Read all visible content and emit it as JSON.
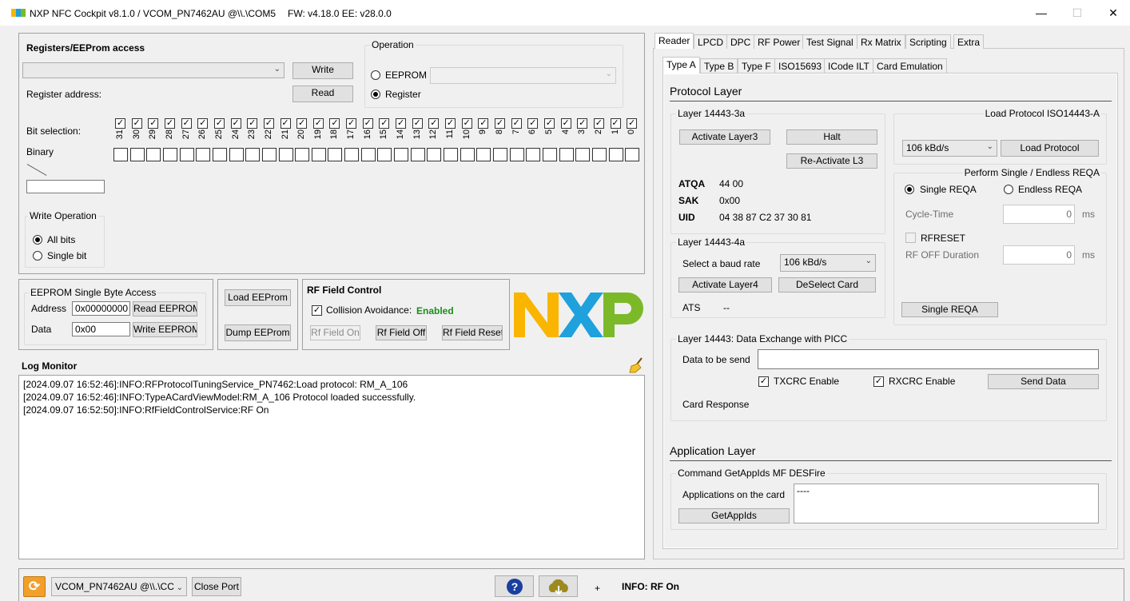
{
  "title": "NXP NFC Cockpit v8.1.0 / VCOM_PN7462AU @\\\\.\\COM5",
  "fw": "FW: v4.18.0 EE: v28.0.0",
  "window_controls": {
    "minimize": "—",
    "maximize": "☐",
    "close": "✕"
  },
  "registers": {
    "heading": "Registers/EEProm access",
    "write": "Write",
    "read": "Read",
    "register_address": "Register address:",
    "bit_selection": "Bit selection:",
    "binary": "Binary",
    "bits": [
      "31",
      "30",
      "29",
      "28",
      "27",
      "26",
      "25",
      "24",
      "23",
      "22",
      "21",
      "20",
      "19",
      "18",
      "17",
      "16",
      "15",
      "14",
      "13",
      "12",
      "11",
      "10",
      "9",
      "8",
      "7",
      "6",
      "5",
      "4",
      "3",
      "2",
      "1",
      "0"
    ],
    "operation": {
      "caption": "Operation",
      "eeprom": "EEPROM",
      "register": "Register",
      "selected": "register"
    },
    "write_operation": {
      "caption": "Write Operation",
      "all_bits": "All bits",
      "single_bit": "Single bit",
      "selected": "all_bits"
    }
  },
  "eeprom_single": {
    "caption": "EEPROM Single Byte Access",
    "address_label": "Address",
    "address_value": "0x00000000",
    "data_label": "Data",
    "data_value": "0x00",
    "read": "Read EEPROM",
    "write": "Write EEPROM"
  },
  "eeprom_actions": {
    "load": "Load EEProm",
    "dump": "Dump EEProm"
  },
  "rf_field": {
    "heading": "RF Field Control",
    "collision": "Collision Avoidance:",
    "collision_state": "Enabled",
    "on": "Rf Field On",
    "off": "Rf Field Off",
    "reset": "Rf Field Reset"
  },
  "logo": "NXP",
  "log": {
    "heading": "Log Monitor",
    "lines": [
      "[2024.09.07 16:52:46]:INFO:RFProtocolTuningService_PN7462:Load protocol: RM_A_106",
      "[2024.09.07 16:52:46]:INFO:TypeACardViewModel:RM_A_106 Protocol loaded successfully.",
      "[2024.09.07 16:52:50]:INFO:RfFieldControlService:RF On"
    ]
  },
  "tabs": [
    "Reader",
    "LPCD",
    "DPC",
    "RF Power",
    "Test Signal",
    "Rx Matrix",
    "Scripting",
    "Extra"
  ],
  "subtabs": [
    "Type A",
    "Type B",
    "Type F",
    "ISO15693",
    "ICode ILT",
    "Card Emulation"
  ],
  "reader": {
    "protocol_layer": "Protocol Layer",
    "layer3": {
      "caption": "Layer 14443-3a",
      "activate": "Activate Layer3",
      "halt": "Halt",
      "reactivate": "Re-Activate L3",
      "atqa_label": "ATQA",
      "atqa": "44 00",
      "sak_label": "SAK",
      "sak": "0x00",
      "uid_label": "UID",
      "uid": "04 38 87 C2 37 30 81"
    },
    "load_protocol": {
      "caption": "Load Protocol ISO14443-A",
      "rate": "106 kBd/s",
      "button": "Load Protocol"
    },
    "reqa": {
      "caption": "Perform Single / Endless REQA",
      "single": "Single REQA",
      "endless": "Endless REQA",
      "cycle_time": "Cycle-Time",
      "cycle_value": "0",
      "ms1": "ms",
      "rfreset": "RFRESET",
      "rf_off": "RF OFF Duration",
      "rf_off_value": "0",
      "ms2": "ms",
      "button": "Single REQA"
    },
    "layer4": {
      "caption": "Layer 14443-4a",
      "baud_label": "Select a baud rate",
      "baud": "106 kBd/s",
      "activate": "Activate Layer4",
      "deselect": "DeSelect Card",
      "ats_label": "ATS",
      "ats": "--"
    },
    "exchange": {
      "caption": "Layer 14443: Data Exchange with PICC",
      "data_label": "Data to be send",
      "txcrc": "TXCRC Enable",
      "rxcrc": "RXCRC Enable",
      "send": "Send Data",
      "response": "Card Response"
    },
    "application_layer": "Application Layer",
    "getappids": {
      "caption": "Command GetAppIds MF DESFire",
      "apps_label": "Applications on the card",
      "apps_value": "----",
      "button": "GetAppIds"
    }
  },
  "statusbar": {
    "port": "VCOM_PN7462AU @\\\\.\\CC",
    "close_port": "Close Port",
    "plus": "+",
    "info": "INFO: RF On"
  },
  "colors": {
    "nxp_yellow": "#f9b500",
    "nxp_blue": "#1ea1dc",
    "nxp_green": "#7bb929",
    "enabled_green": "#1a8f1a"
  }
}
